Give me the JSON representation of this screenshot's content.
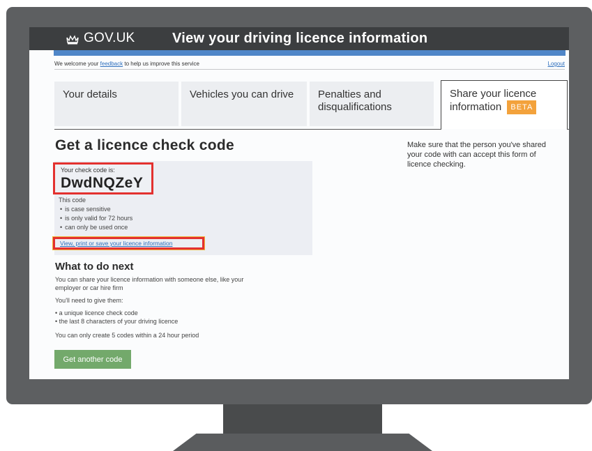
{
  "header": {
    "logo_text": "GOV.UK",
    "service_title": "View your driving licence information"
  },
  "phase_banner": {
    "text_before": "We welcome your ",
    "feedback_link": "feedback",
    "text_after": " to help us improve this service",
    "logout": "Logout"
  },
  "tabs": [
    {
      "label": "Your details",
      "active": false
    },
    {
      "label": "Vehicles you can drive",
      "active": false
    },
    {
      "label": "Penalties and disqualifications",
      "active": false
    },
    {
      "label": "Share your licence information",
      "badge": "BETA",
      "active": true
    }
  ],
  "main": {
    "heading": "Get a licence check code",
    "code_intro": "Your check code is:",
    "check_code": "DwdNQZeY",
    "code_notes_intro": "This code",
    "code_notes": [
      "is case sensitive",
      "is only valid for 72 hours",
      "can only be used once"
    ],
    "view_link": "View, print or save your licence information",
    "side_note": "Make sure that the person you've shared your code with can accept this form of licence checking."
  },
  "next": {
    "heading": "What to do next",
    "para1": "You can share your licence information with someone else, like your employer or car hire firm",
    "para2": "You'll need to give them:",
    "items": [
      "a unique licence check code",
      "the last 8 characters of your driving licence"
    ],
    "para3": "You can only create 5 codes within a 24 hour period",
    "button": "Get another code"
  },
  "colors": {
    "header_bg": "#3c3e40",
    "blue_bar": "#4f86c8",
    "highlight_border": "#e3312f",
    "beta_badge": "#f3a23c",
    "button_green": "#73a96b",
    "monitor": "#5d5f61"
  },
  "icons": {
    "logo": "crown-icon"
  }
}
